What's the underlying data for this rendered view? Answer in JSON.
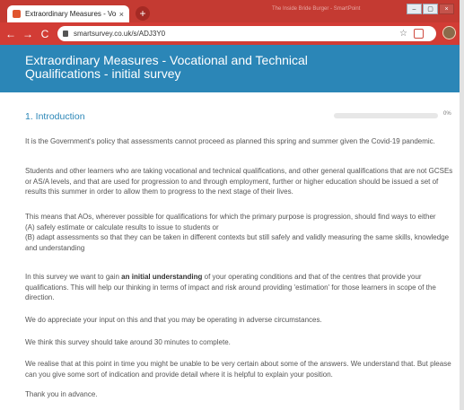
{
  "browser": {
    "tab_title": "Extraordinary Measures - Vocatio",
    "tab_close": "×",
    "new_tab": "+",
    "window_title": "The Inside Bride Burger - SmartPoint",
    "url": "smartsurvey.co.uk/s/ADJ3Y0",
    "nav": {
      "back": "←",
      "forward": "→",
      "reload": "C"
    }
  },
  "survey": {
    "title": "Extraordinary Measures - Vocational and Technical Qualifications - initial survey",
    "section_title": "1. Introduction",
    "progress_percent": 0,
    "progress_label": "0%"
  },
  "paragraphs": [
    {
      "text": "It is the Government's policy that assessments cannot proceed as planned this spring and summer given the Covid-19 pandemic."
    },
    {
      "text": "Students and other learners who are taking vocational and technical qualifications, and other general qualifications that are not GCSEs or AS/A levels, and that are used for progression to and through employment, further or higher education should be issued a set of results this summer in order to allow them to progress to the next stage of their lives."
    },
    {
      "lines": [
        "This means that AOs, wherever possible for qualifications for which the primary purpose is progression, should find ways to either",
        "(A) safely estimate or calculate results to issue to students or",
        "(B) adapt assessments so that they can be taken in different contexts but still safely and validly measuring the same skills, knowledge and understanding"
      ]
    },
    {
      "prefix": "In this survey we want to gain ",
      "bold": "an initial understanding",
      "suffix": " of your operating conditions and that of the centres that provide your qualifications.  This will help our thinking in terms of impact and risk around providing 'estimation' for those learners in scope of the direction."
    },
    {
      "text": "We do appreciate your input on this and that you may be operating in adverse circumstances."
    },
    {
      "text": "We think this survey should take around 30 minutes to complete."
    },
    {
      "text": "We realise that at this point in time you might be unable to be very certain about some of the answers.  We understand that. But please can you give some sort of indication and provide detail where it is helpful to explain your position."
    },
    {
      "text": "Thank you in advance."
    }
  ]
}
